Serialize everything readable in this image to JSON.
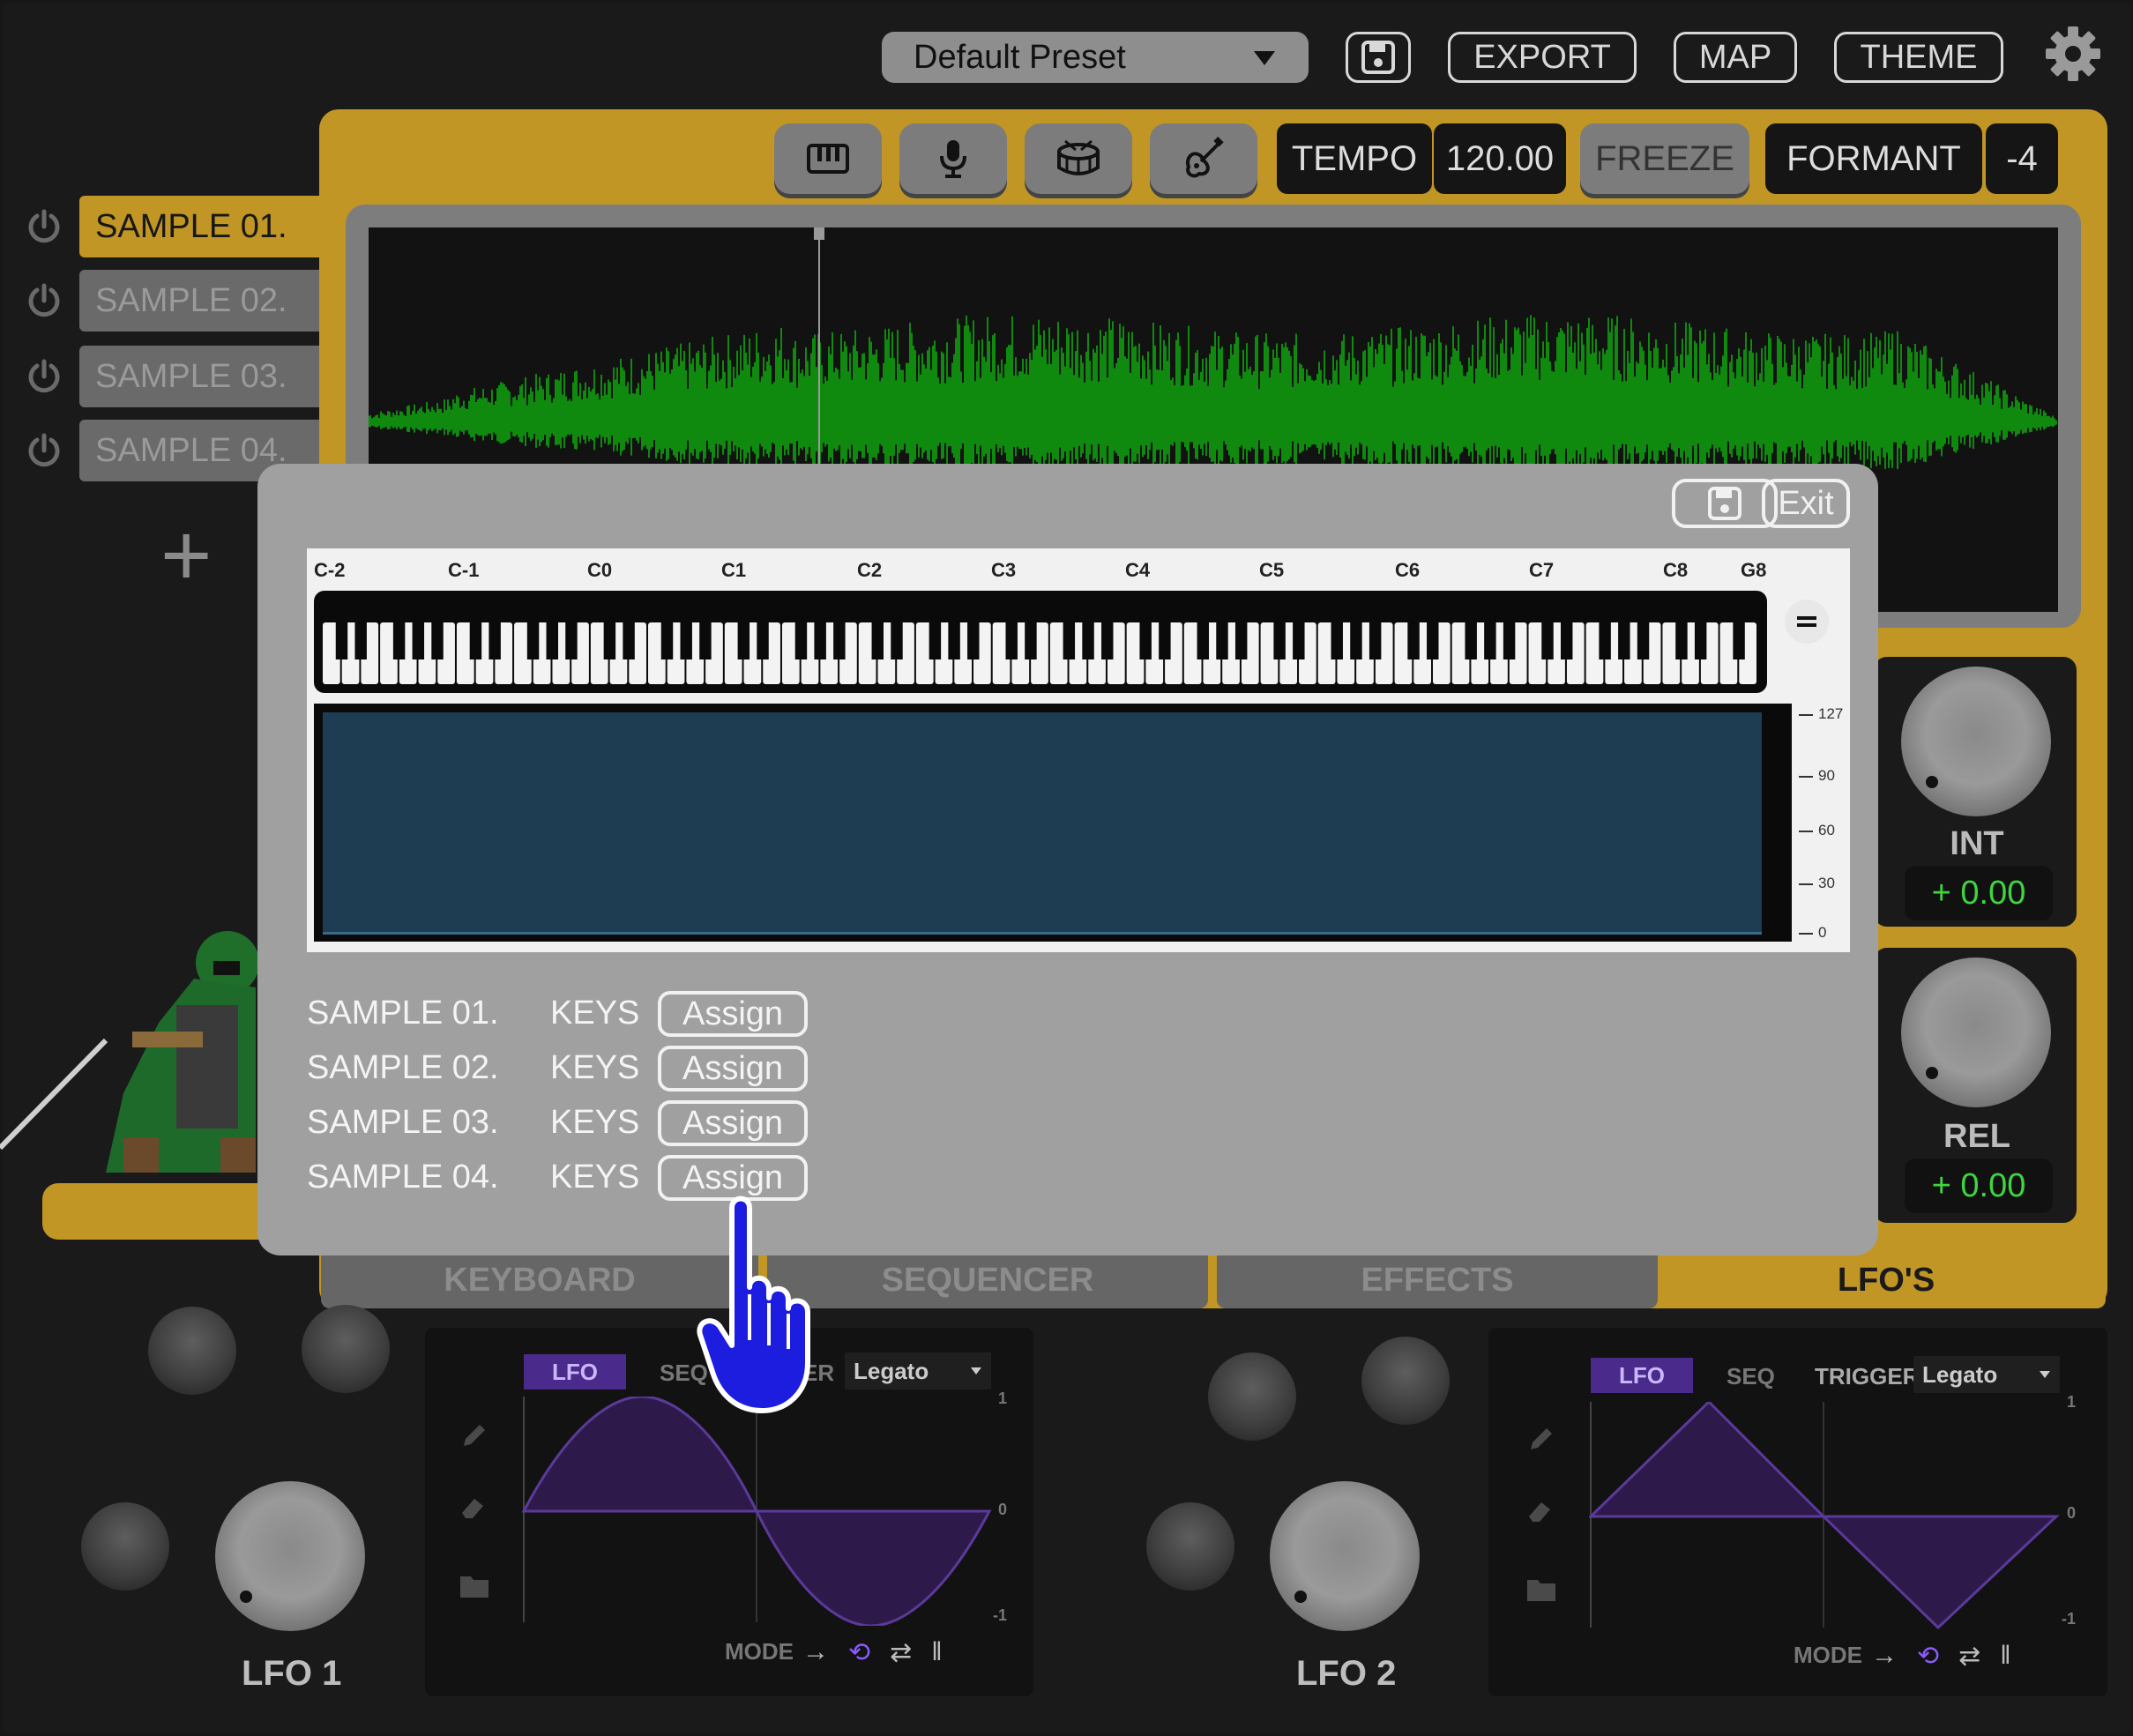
{
  "header": {
    "preset": "Default Preset",
    "save_icon": "floppy-disk-icon",
    "buttons": [
      "EXPORT",
      "MAP",
      "THEME"
    ],
    "settings_icon": "gear-icon"
  },
  "toolbar": {
    "modes": [
      "piano-keys-icon",
      "microphone-icon",
      "drum-icon",
      "guitar-icon"
    ],
    "tempo_label": "TEMPO",
    "tempo_value": "120.00",
    "freeze_label": "FREEZE",
    "formant_label": "FORMANT",
    "formant_value": "-4"
  },
  "samples": [
    {
      "label": "SAMPLE 01.",
      "active": true
    },
    {
      "label": "SAMPLE 02.",
      "active": false
    },
    {
      "label": "SAMPLE 03.",
      "active": false
    },
    {
      "label": "SAMPLE 04.",
      "active": false
    }
  ],
  "add_sample_glyph": "+",
  "envelope": {
    "int": {
      "label": "INT",
      "value": "+ 0.00"
    },
    "rel": {
      "label": "REL",
      "value": "+ 0.00"
    }
  },
  "tabs": [
    {
      "label": "KEYBOARD",
      "active": false
    },
    {
      "label": "SEQUENCER",
      "active": false
    },
    {
      "label": "EFFECTS",
      "active": false
    },
    {
      "label": "LFO'S",
      "active": true
    }
  ],
  "lfo1": {
    "label": "LFO 1",
    "tab_lfo": "LFO",
    "tab_seq": "SEQ",
    "trigger_label": "ER",
    "trigger_value": "Legato",
    "mode_label": "MODE",
    "scale": [
      "1",
      "0",
      "-1"
    ]
  },
  "lfo2": {
    "label": "LFO 2",
    "tab_lfo": "LFO",
    "tab_seq": "SEQ",
    "trigger_label": "TRIGGER",
    "trigger_value": "Legato",
    "mode_label": "MODE",
    "scale": [
      "1",
      "0",
      "-1"
    ]
  },
  "mapping_dialog": {
    "save_icon": "floppy-disk-icon",
    "exit_label": "Exit",
    "octaves": [
      "C-2",
      "C-1",
      "C0",
      "C1",
      "C2",
      "C3",
      "C4",
      "C5",
      "C6",
      "C7",
      "C8",
      "G8"
    ],
    "velocity_ticks": [
      "127",
      "90",
      "60",
      "30",
      "0"
    ],
    "rows": [
      {
        "sample": "SAMPLE 01.",
        "type": "KEYS",
        "action": "Assign"
      },
      {
        "sample": "SAMPLE 02.",
        "type": "KEYS",
        "action": "Assign"
      },
      {
        "sample": "SAMPLE 03.",
        "type": "KEYS",
        "action": "Assign"
      },
      {
        "sample": "SAMPLE 04.",
        "type": "KEYS",
        "action": "Assign"
      }
    ]
  },
  "colors": {
    "accent_gold": "#c19624",
    "waveform_green": "#0f8a0f",
    "value_green": "#3fd53f",
    "lfo_purple": "#4a2a8a",
    "pointer_blue": "#1d1ddf"
  }
}
